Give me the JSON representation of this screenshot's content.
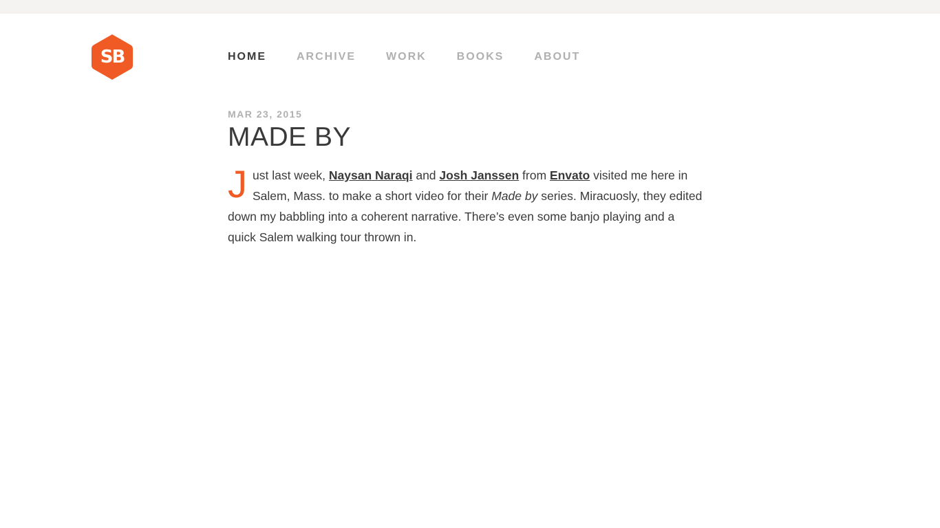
{
  "brand": {
    "logo_text": "SB",
    "accent_color": "#f05a24"
  },
  "nav": {
    "items": [
      {
        "label": "HOME",
        "active": true
      },
      {
        "label": "ARCHIVE",
        "active": false
      },
      {
        "label": "WORK",
        "active": false
      },
      {
        "label": "BOOKS",
        "active": false
      },
      {
        "label": "ABOUT",
        "active": false
      }
    ]
  },
  "post": {
    "date": "MAR 23, 2015",
    "title": "MADE BY",
    "body": {
      "dropcap": "J",
      "t1": "ust last week, ",
      "link1": "Naysan Naraqi",
      "t2": " and ",
      "link2": "Josh Janssen",
      "t3": " from ",
      "link3": "Envato",
      "t4": " visited me here in Salem, Mass. to make a short video for their ",
      "em1": "Made by",
      "t5": " series. Miracuosly, they edited down my babbling into a coherent narrative. There’s even some banjo playing and a quick Salem walking tour thrown in."
    }
  }
}
